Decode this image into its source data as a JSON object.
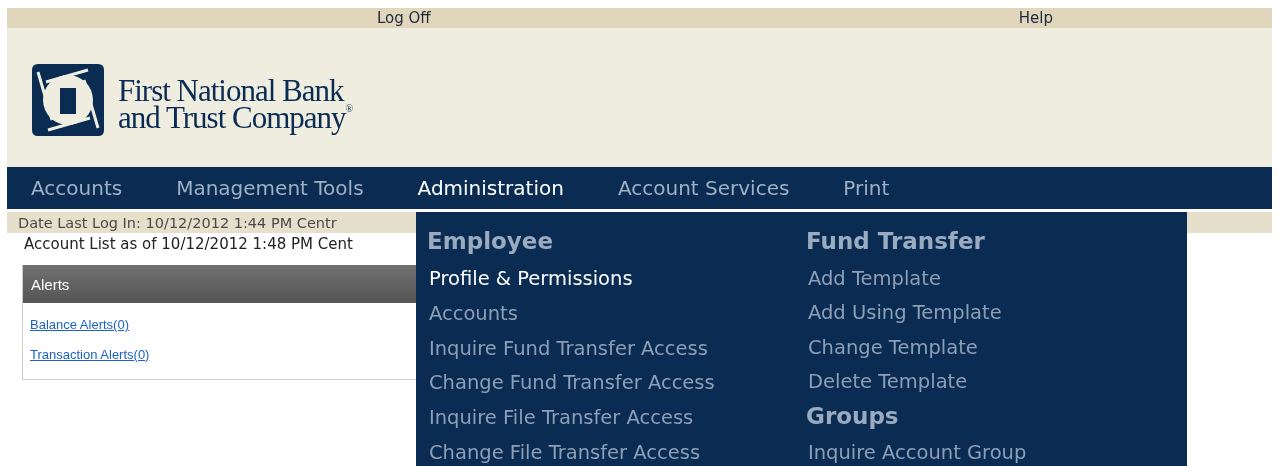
{
  "top_links": [
    "Log Off",
    "Help"
  ],
  "logo": {
    "line1": "First National Bank",
    "line2": "and Trust Company$^{®}$"
  },
  "nav": [
    {
      "label": "Accounts",
      "selected": false
    },
    {
      "label": "Management Tools",
      "selected": false
    },
    {
      "label": "Administration",
      "selected": true
    },
    {
      "label": "Account Services",
      "selected": false
    },
    {
      "label": "Print",
      "selected": false
    }
  ],
  "last_login": "Date Last Log In: 10/12/2012 1:44 PM Centr",
  "account_list": "Account List as of 10/12/2012 1:48 PM Cent",
  "alerts": {
    "title": "Alerts",
    "links": [
      "Balance Alerts(0)",
      "Transaction Alerts(0)"
    ]
  },
  "menu": {
    "columns": [
      [
        {
          "heading": "Employee",
          "items": [
            {
              "label": "Profile & Permissions",
              "selected": true
            },
            {
              "label": "Accounts",
              "selected": false
            },
            {
              "label": "Inquire Fund Transfer Access",
              "selected": false
            },
            {
              "label": "Change Fund Transfer Access",
              "selected": false
            },
            {
              "label": "Inquire File Transfer Access",
              "selected": false
            },
            {
              "label": "Change File Transfer Access",
              "selected": false
            }
          ]
        }
      ],
      [
        {
          "heading": "Fund Transfer",
          "items": [
            {
              "label": "Add Template",
              "selected": false
            },
            {
              "label": "Add Using Template",
              "selected": false
            },
            {
              "label": "Change Template",
              "selected": false
            },
            {
              "label": "Delete Template",
              "selected": false
            }
          ]
        },
        {
          "heading": "Groups",
          "items": [
            {
              "label": "Inquire Account Group",
              "selected": false
            }
          ]
        }
      ]
    ]
  }
}
